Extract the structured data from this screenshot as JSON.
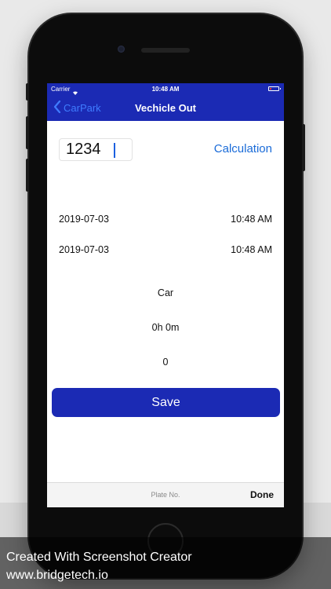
{
  "status_bar": {
    "carrier": "Carrier",
    "time": "10:48 AM"
  },
  "nav": {
    "back_label": "CarPark",
    "title": "Vechicle Out"
  },
  "form": {
    "plate_value": "1234",
    "calculation_label": "Calculation",
    "entry_date": "2019-07-03",
    "entry_time": "10:48 AM",
    "exit_date": "2019-07-03",
    "exit_time": "10:48 AM",
    "vehicle_type": "Car",
    "duration": "0h 0m",
    "amount": "0",
    "save_label": "Save"
  },
  "keyboard_toolbar": {
    "label": "Plate No.",
    "done_label": "Done"
  },
  "caption": {
    "line1": "Created With Screenshot Creator",
    "line2": "www.bridgetech.io"
  },
  "colors": {
    "accent_blue": "#1b2ab4",
    "link_blue": "#1a6bd8",
    "back_blue": "#3f7cff"
  },
  "icons": {
    "back": "chevron-left-icon",
    "wifi": "wifi-icon",
    "battery": "battery-icon"
  }
}
